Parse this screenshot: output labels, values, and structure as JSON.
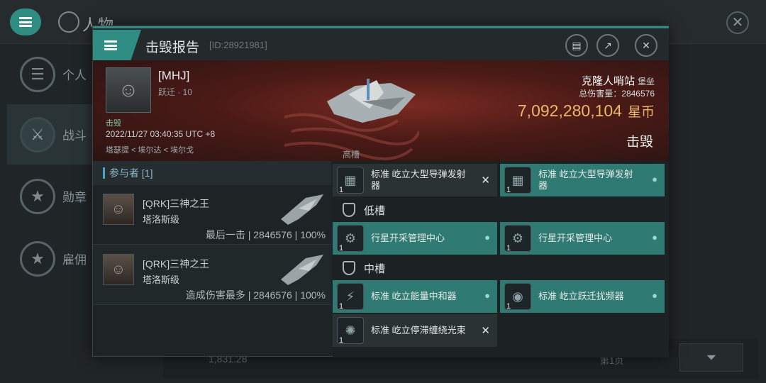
{
  "background": {
    "title": "人物",
    "side_items": [
      {
        "label": "个人",
        "icon": "list-icon"
      },
      {
        "label": "战斗",
        "icon": "crossed-swords-icon"
      },
      {
        "label": "勋章",
        "icon": "star-badge-icon"
      },
      {
        "label": "雇佣",
        "icon": "star-circle-icon"
      }
    ],
    "bottom_value": "1,831.28",
    "bottom_page": "第1页"
  },
  "dialog": {
    "title": "击毁报告",
    "id_text": "[ID:28921981]",
    "victim": {
      "name": "[MHJ]",
      "corp": "跃迁 · 10",
      "tag": "击毁",
      "time": "2022/11/27 03:40:35 UTC +8",
      "location": "塔瑟提 < 埃尔达 < 埃尔戈"
    },
    "target": {
      "name": "克隆人哨站",
      "type": "堡垒",
      "total_damage_label": "总伤害量",
      "total_damage": "2846576",
      "isk_value": "7,092,280,104",
      "currency": "星币",
      "status": "击毁"
    },
    "participants": {
      "header": "参与者 [1]",
      "rows": [
        {
          "name": "[QRK]三神之王",
          "ship": "塔洛斯级",
          "role": "最后一击",
          "damage": "2846576",
          "percent": "100%"
        },
        {
          "name": "[QRK]三神之王",
          "ship": "塔洛斯级",
          "role": "造成伤害最多",
          "damage": "2846576",
          "percent": "100%"
        }
      ]
    },
    "fitting": {
      "high_label": "高槽",
      "low_label": "低槽",
      "mid_label": "中槽",
      "high": [
        {
          "label": "标准 屹立大型导弹发射器",
          "qty": "1",
          "state": "destroyed"
        },
        {
          "label": "标准 屹立大型导弹发射器",
          "qty": "1",
          "state": "dropped"
        }
      ],
      "low": [
        {
          "label": "行星开采管理中心",
          "qty": "1",
          "state": "dropped"
        },
        {
          "label": "行星开采管理中心",
          "qty": "1",
          "state": "dropped"
        }
      ],
      "mid": [
        {
          "label": "标准 屹立能量中和器",
          "qty": "1",
          "state": "dropped"
        },
        {
          "label": "标准 屹立跃迁扰频器",
          "qty": "1",
          "state": "dropped"
        },
        {
          "label": "标准 屹立停滞缠绕光束",
          "qty": "1",
          "state": "destroyed"
        }
      ]
    }
  }
}
